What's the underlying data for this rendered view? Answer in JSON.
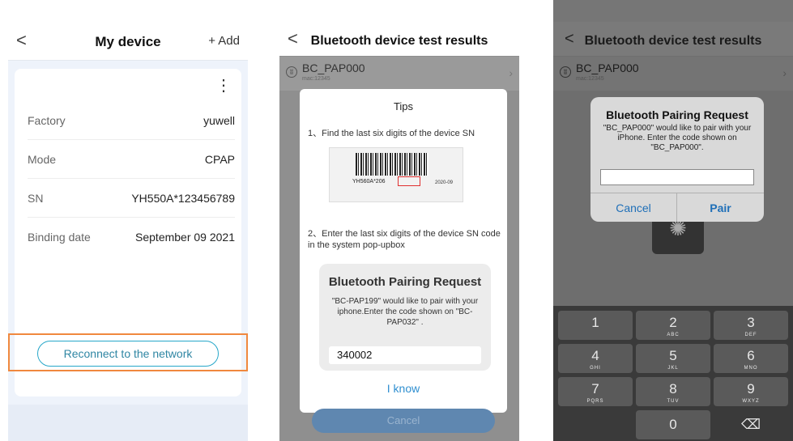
{
  "screen1": {
    "title": "My device",
    "back": "<",
    "add": "+ Add",
    "menu": "⋮",
    "rows": [
      {
        "label": "Factory",
        "value": "yuwell"
      },
      {
        "label": "Mode",
        "value": "CPAP"
      },
      {
        "label": "SN",
        "value": "YH550A*123456789"
      },
      {
        "label": "Binding date",
        "value": "September 09 2021"
      }
    ],
    "reconnect": "Reconnect to the network"
  },
  "screen2": {
    "title": "Bluetooth device test results",
    "back": "<",
    "device_name": "BC_PAP000",
    "device_mac": "mac:12345",
    "tips_title": "Tips",
    "step1": "1、Find the last six digits of the device SN",
    "barcode_text": "YH560A*206",
    "barcode_highlight": "040002",
    "barcode_date": "2020-09",
    "step2": "2、Enter the last six digits of the device SN code in the system pop-upbox",
    "pairing_title": "Bluetooth Pairing Request",
    "pairing_msg": "\"BC-PAP199\" would like to pair with your iphone.Enter the code shown on \"BC-PAP032\" .",
    "pairing_input": "340002",
    "i_know": "I know",
    "cancel": "Cancel"
  },
  "screen3": {
    "title": "Bluetooth device test results",
    "back": "<",
    "device_name": "BC_PAP000",
    "device_mac": "mac:12345",
    "alert_title": "Bluetooth Pairing Request",
    "alert_msg": "\"BC_PAP000\" would like to pair with your iPhone. Enter the code shown on \"BC_PAP000\".",
    "cancel": "Cancel",
    "pair": "Pair",
    "keys": [
      {
        "n": "1",
        "l": ""
      },
      {
        "n": "2",
        "l": "ABC"
      },
      {
        "n": "3",
        "l": "DEF"
      },
      {
        "n": "4",
        "l": "GHI"
      },
      {
        "n": "5",
        "l": "JKL"
      },
      {
        "n": "6",
        "l": "MNO"
      },
      {
        "n": "7",
        "l": "PQRS"
      },
      {
        "n": "8",
        "l": "TUV"
      },
      {
        "n": "9",
        "l": "WXYZ"
      },
      {
        "n": "0",
        "l": ""
      }
    ],
    "delete_key": "⌫"
  }
}
